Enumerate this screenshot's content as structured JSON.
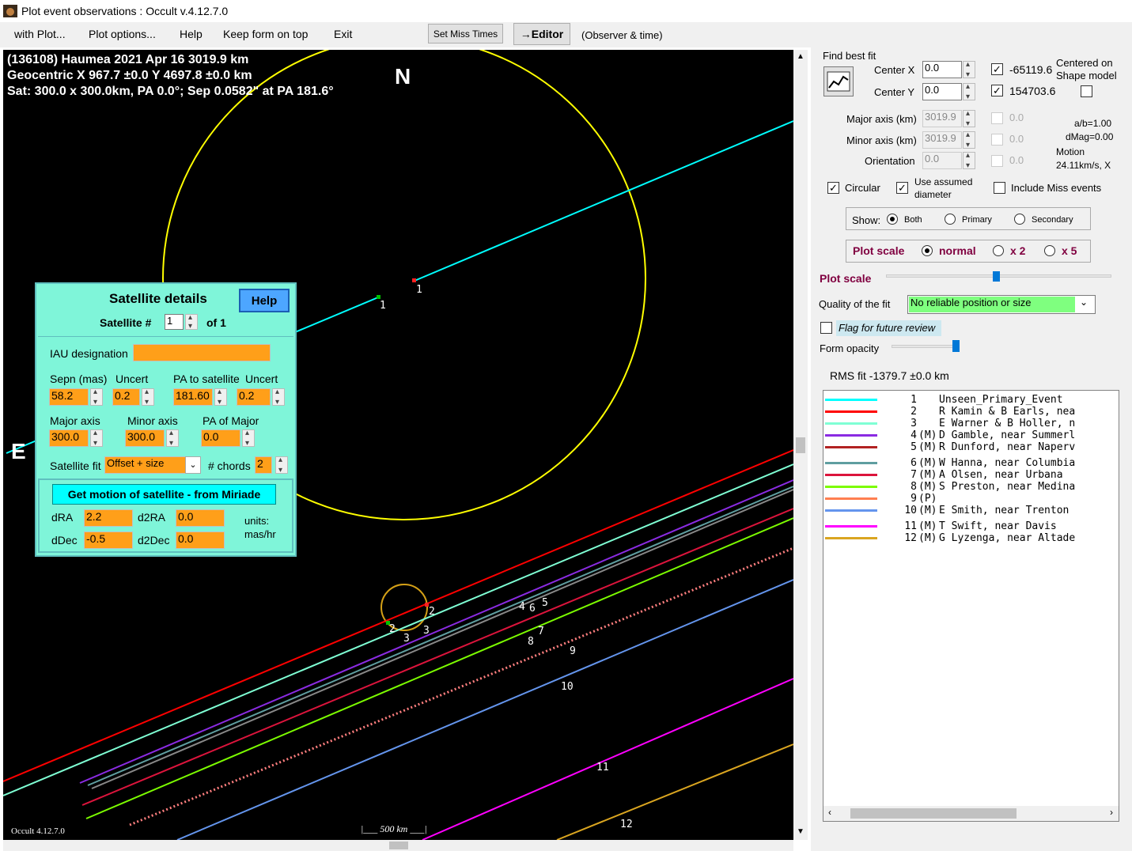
{
  "window": {
    "title": "Plot event observations : Occult v.4.12.7.0"
  },
  "menu": {
    "with_plot": "with Plot...",
    "plot_options": "Plot options...",
    "help": "Help",
    "keep_on_top": "Keep form on top",
    "exit": "Exit",
    "set_miss": "Set Miss Times",
    "editor": "→Editor",
    "observer": "(Observer & time)"
  },
  "plot": {
    "line1": "(136108) Haumea  2021 Apr 16   3019.9 km",
    "line2": "Geocentric  X  967.7 ±0.0  Y 4697.8 ±0.0 km",
    "line3": "Sat:  300.0 x 300.0km,  PA 0.0°;  Sep 0.0582\" at PA 181.6°",
    "north": "N",
    "east": "E",
    "version": "Occult 4.12.7.0",
    "scale": "500 km",
    "chord_labels": [
      "1",
      "1",
      "2",
      "2",
      "3",
      "3",
      "4",
      "5",
      "6",
      "7",
      "8",
      "9",
      "10",
      "11",
      "12"
    ]
  },
  "satellite": {
    "title": "Satellite details",
    "help": "Help",
    "num_label": "Satellite #",
    "num": "1",
    "of": "of  1",
    "iau_label": "IAU designation",
    "iau": "",
    "sepn_label": "Sepn (mas)",
    "uncert_label": "Uncert",
    "pa_label": "PA to satellite",
    "uncert2_label": "Uncert",
    "sepn": "58.2",
    "sepn_unc": "0.2",
    "pa": "181.60",
    "pa_unc": "0.2",
    "major_label": "Major axis",
    "minor_label": "Minor axis",
    "pamaj_label": "PA of Major",
    "major": "300.0",
    "minor": "300.0",
    "pamaj": "0.0",
    "fit_label": "Satellite fit",
    "fit": "Offset + size",
    "chords_label": "# chords",
    "chords": "2",
    "motion_btn": "Get motion of satellite - from Miriade",
    "dra_label": "dRA",
    "dra": "2.2",
    "d2ra_label": "d2RA",
    "d2ra": "0.0",
    "ddec_label": "dDec",
    "ddec": "-0.5",
    "d2dec_label": "d2Dec",
    "d2dec": "0.0",
    "units": "units:",
    "units2": "mas/hr"
  },
  "fit": {
    "find_best": "Find best fit",
    "cx_label": "Center X",
    "cx": "0.0",
    "cy_label": "Center Y",
    "cy": "0.0",
    "cx_val": "-65119.6",
    "cy_val": "154703.6",
    "centered": "Centered on",
    "shape": "Shape model",
    "major_label": "Major axis (km)",
    "major": "3019.9",
    "minor_label": "Minor axis (km)",
    "minor": "3019.9",
    "orient_label": "Orientation",
    "orient": "0.0",
    "z1": "0.0",
    "z2": "0.0",
    "z3": "0.0",
    "ab": "a/b=1.00",
    "dmag": "dMag=0.00",
    "motion": "Motion",
    "motion_val": "24.11km/s, X",
    "circular": "Circular",
    "use_assumed": "Use assumed",
    "diameter": "diameter",
    "include_miss": "Include Miss events",
    "show": "Show:",
    "both": "Both",
    "primary": "Primary",
    "secondary": "Secondary",
    "plot_scale": "Plot scale",
    "normal": "normal",
    "x2": "x 2",
    "x5": "x 5",
    "plot_scale2": "Plot scale",
    "quality_label": "Quality of the fit",
    "quality": "No reliable position or size",
    "flag": "Flag for future review",
    "opacity": "Form opacity",
    "rms": "RMS fit -1379.7 ±0.0 km"
  },
  "legend": [
    {
      "color": "#00ffff",
      "idx": "1",
      "flag": "",
      "name": "Unseen_Primary_Event"
    },
    {
      "color": "#ff0000",
      "idx": "2",
      "flag": "",
      "name": "R Kamin & B Earls, nea"
    },
    {
      "color": "#7fffd4",
      "idx": "3",
      "flag": "",
      "name": "E Warner & B Holler, n"
    },
    {
      "color": "#8a2be2",
      "idx": "4",
      "flag": "(M)",
      "name": "D Gamble, near Summerl"
    },
    {
      "color": "#b22222",
      "idx": "5",
      "flag": "(M)",
      "name": "R Dunford, near Naperv"
    },
    {
      "color": "#5f9ea0",
      "idx": "6",
      "flag": "(M)",
      "name": "W Hanna, near Columbia"
    },
    {
      "color": "#dc143c",
      "idx": "7",
      "flag": "(M)",
      "name": "A Olsen, near Urbana"
    },
    {
      "color": "#7cfc00",
      "idx": "8",
      "flag": "(M)",
      "name": "S Preston, near Medina"
    },
    {
      "color": "#ff7f50",
      "idx": "9",
      "flag": "(P)",
      "name": ""
    },
    {
      "color": "#6495ed",
      "idx": "10",
      "flag": "(M)",
      "name": "E Smith, near Trenton"
    },
    {
      "color": "#ff00ff",
      "idx": "11",
      "flag": "(M)",
      "name": "T Swift, near Davis"
    },
    {
      "color": "#daa520",
      "idx": "12",
      "flag": "(M)",
      "name": "G Lyzenga, near Altade"
    }
  ]
}
